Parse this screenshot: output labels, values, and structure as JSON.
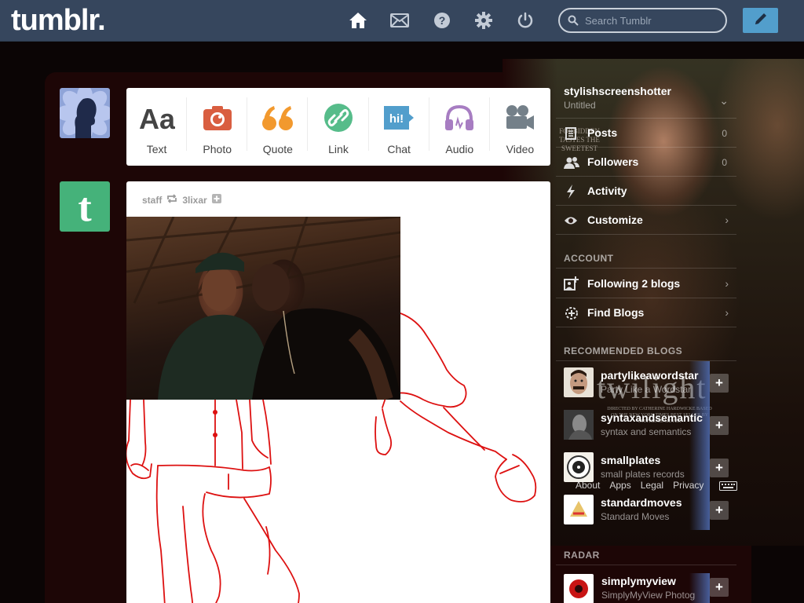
{
  "header": {
    "logo": "tumblr.",
    "search_placeholder": "Search Tumblr",
    "nav": [
      "home-icon",
      "mail-icon",
      "help-icon",
      "gear-icon",
      "power-icon"
    ],
    "compose_icon": "pencil-icon"
  },
  "post_types": [
    {
      "label": "Text",
      "icon": "text-icon",
      "color": "#444444"
    },
    {
      "label": "Photo",
      "icon": "camera-icon",
      "color": "#d95e40"
    },
    {
      "label": "Quote",
      "icon": "quote-icon",
      "color": "#f2992e"
    },
    {
      "label": "Link",
      "icon": "link-icon",
      "color": "#56bc8a"
    },
    {
      "label": "Chat",
      "icon": "chat-icon",
      "color": "#529ecc"
    },
    {
      "label": "Audio",
      "icon": "headphones-icon",
      "color": "#a77dc2"
    },
    {
      "label": "Video",
      "icon": "video-icon",
      "color": "#748089"
    }
  ],
  "post": {
    "author": "staff",
    "reblogged_from": "3lixar"
  },
  "background_text": {
    "tagline": "FORBIDDEN TASTES THE SWEETEST",
    "movie_title": "twilight",
    "credits": "DIRECTED BY CATHERINE HARDWICKE BASED ON THE NEW YORK TIMES BEST SELLER BY STEPHENIE MEYER"
  },
  "sidebar": {
    "blog_name": "stylishscreenshotter",
    "blog_subtitle": "Untitled",
    "items": [
      {
        "label": "Posts",
        "count": "0",
        "icon": "posts-icon"
      },
      {
        "label": "Followers",
        "count": "0",
        "icon": "followers-icon"
      },
      {
        "label": "Activity",
        "icon": "activity-icon"
      },
      {
        "label": "Customize",
        "icon": "eye-icon"
      }
    ],
    "account_heading": "ACCOUNT",
    "account_items": [
      {
        "label": "Following 2 blogs",
        "icon": "following-icon"
      },
      {
        "label": "Find Blogs",
        "icon": "find-blogs-icon"
      }
    ],
    "recommended_heading": "RECOMMENDED BLOGS",
    "recommended": [
      {
        "name": "partylikeawordstar",
        "sub": "Party Like a Wordstar"
      },
      {
        "name": "syntaxandsemantic",
        "sub": "syntax and semantics"
      },
      {
        "name": "smallplates",
        "sub": "small plates records"
      },
      {
        "name": "standardmoves",
        "sub": "Standard Moves"
      }
    ],
    "radar_heading": "RADAR",
    "radar": [
      {
        "name": "simplymyview",
        "sub": "SimplyMyView Photog"
      }
    ],
    "footer_links": [
      "About",
      "Apps",
      "Legal",
      "Privacy"
    ]
  },
  "colors": {
    "header_bg": "#36465d",
    "compose_blue": "#529ecc",
    "dashboard_bg": "#1d0606",
    "staff_green": "#45b27a",
    "drawing_red": "#dd1111"
  }
}
